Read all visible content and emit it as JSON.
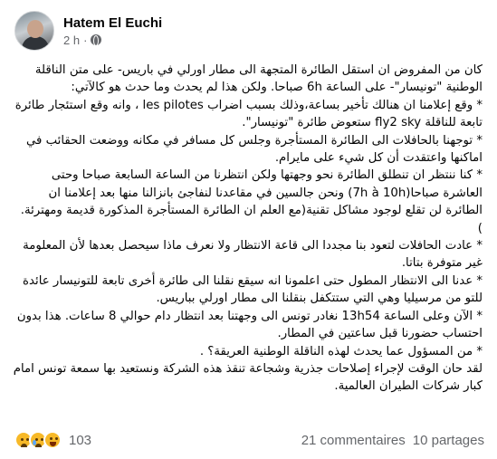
{
  "post": {
    "author": "Hatem El Euchi",
    "time": "2 h",
    "separator": "·",
    "paragraphs": [
      "كان من المفروض ان استقل الطائرة المتجهة الى مطار اورلي في باريس- على متن الناقلة الوطنية \"تونيسار\"- على الساعة 6h صباحا. ولكن هذا لم يحدث وما حدث هو كالآتي:",
      "* وقع إعلامنا ان هنالك تأخير بساعة،وذلك بسبب اضراب les pilotes ، وانه وقع استئجار طائرة تابعة للناقلة fly2 sky ستعوض طائرة \"تونيسار\".",
      "* توجهنا بالحافلات الى الطائرة المستأجرة وجلس كل مسافر في مكانه ووضعت الحقائب في اماكنها واعتقدت أن كل شيء على مايرام.",
      "* كنا ننتظر ان تنطلق الطائرة نحو وجهتها ولكن انتظرنا من الساعة السابعة صباحا وحتى العاشرة صباحا(7h à 10h) ونحن جالسين في مقاعدنا لنفاجئ بانزالنا منها بعد إعلامنا ان الطائرة لن تقلع لوجود مشاكل تقنية(مع العلم ان الطائرة المستأجرة المذكورة قديمة ومهترئة. )",
      "* عادت الحافلات لتعود بنا مجددا الى قاعة الانتظار ولا نعرف ماذا سيحصل بعدها لأن المعلومة غير متوفرة بتاتا.",
      "* عدنا الى الانتظار المطول حتى اعلمونا انه سيقع نقلنا الى طائرة أخرى تابعة للتونيسار عائدة للتو من مرسيليا وهي التي ستتكفل بنقلنا الى مطار اورلي بباريس.",
      "* الآن وعلى الساعة 13h54 نغادر تونس الى وجهتنا بعد انتظار دام حوالي 8 ساعات. هذا بدون احتساب حضورنا قبل ساعتين في المطار.",
      "* من المسؤول عما يحدث لهذه الناقلة الوطنية العريقة؟ .",
      "لقد حان الوقت لإجراء إصلاحات جذرية وشجاعة تنقذ هذه الشركة ونستعيد بها سمعة تونس امام كبار شركات الطيران العالمية."
    ]
  },
  "footer": {
    "reaction_icons": [
      "sad-emoji-icon",
      "crying-emoji-icon",
      "haha-emoji-icon"
    ],
    "reaction_count": "103",
    "comments": "21 commentaires",
    "shares": "10 partages"
  },
  "colors": {
    "text": "#050505",
    "muted": "#65676b",
    "reaction_yellow": "#f7b928"
  }
}
